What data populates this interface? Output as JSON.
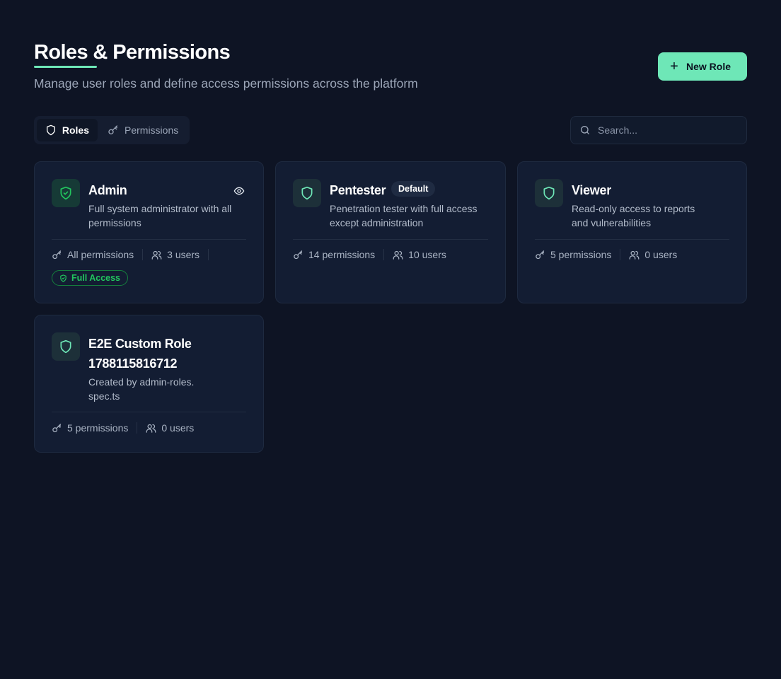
{
  "header": {
    "title": "Roles & Permissions",
    "subtitle": "Manage user roles and define access permissions across the platform",
    "new_role_label": "New Role"
  },
  "tabs": [
    {
      "label": "Roles",
      "icon": "shield-icon",
      "active": true
    },
    {
      "label": "Permissions",
      "icon": "key-icon",
      "active": false
    }
  ],
  "search": {
    "placeholder": "Search...",
    "value": ""
  },
  "roles": [
    {
      "name": "Admin",
      "description": "Full system administrator with all permissions",
      "permissions": "All permissions",
      "users": "3 users",
      "badge": "Full Access"
    },
    {
      "name": "Pentester",
      "tag": "Default",
      "description": "Penetration tester with full access except administration",
      "permissions": "14 permissions",
      "users": "10 users"
    },
    {
      "name": "Viewer",
      "description": "Read-only access to reports and vulnerabilities",
      "permissions": "5 permissions",
      "users": "0 users"
    },
    {
      "name": "E2E Custom Role 1788115816712",
      "description": "Created by admin-roles.spec.ts",
      "permissions": "5 permissions",
      "users": "0 users"
    }
  ],
  "colors": {
    "background": "#0e1424",
    "card": "#131d33",
    "accent": "#6ee7b7",
    "success": "#22c55e"
  }
}
